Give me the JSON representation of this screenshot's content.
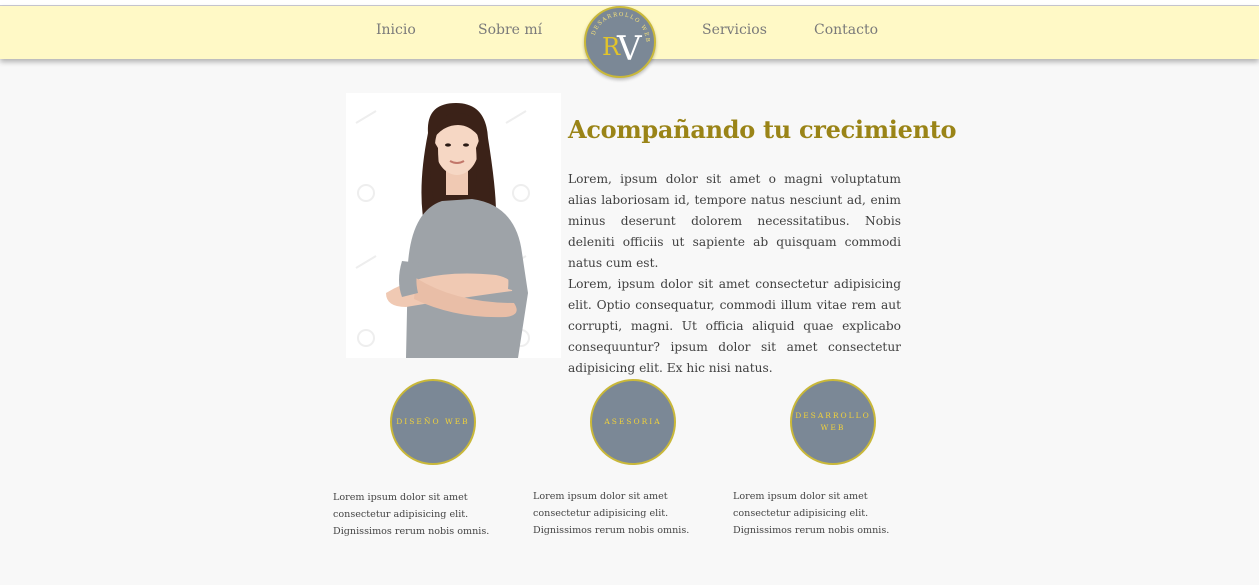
{
  "nav": {
    "items": [
      "Inicio",
      "Sobre mí",
      "Servicios",
      "Contacto"
    ]
  },
  "logo": {
    "initials_r": "R",
    "initials_v": "V",
    "ring_text": "DESARROLLO WEB"
  },
  "hero": {
    "title": "Acompañando tu crecimiento",
    "paragraph1": "Lorem, ipsum dolor sit amet o magni voluptatum alias laboriosam id, tempore natus nesciunt ad, enim minus deserunt dolorem necessitatibus. Nobis deleniti officiis ut sapiente ab quisquam commodi natus cum est.",
    "paragraph2": "Lorem, ipsum dolor sit amet consectetur adipisicing elit. Optio consequatur, commodi illum vitae rem aut corrupti, magni. Ut officia aliquid quae explicabo consequuntur? ipsum dolor sit amet consectetur adipisicing elit. Ex hic nisi natus."
  },
  "services": [
    {
      "label": "DISEÑO WEB",
      "text": "Lorem ipsum dolor sit amet consectetur adipisicing elit. Dignissimos rerum nobis omnis."
    },
    {
      "label": "ASESORIA",
      "text": "Lorem ipsum dolor sit amet consectetur adipisicing elit. Dignissimos rerum nobis omnis."
    },
    {
      "label": "DESARROLLO WEB",
      "text": "Lorem ipsum dolor sit amet consectetur adipisicing elit. Dignissimos rerum nobis omnis."
    }
  ],
  "colors": {
    "navbar_bg": "#fff9c6",
    "accent_gold": "#9a8417",
    "circle_fill": "#7b8896",
    "circle_text": "#f1d23a",
    "page_bg": "#f8f8f8"
  }
}
